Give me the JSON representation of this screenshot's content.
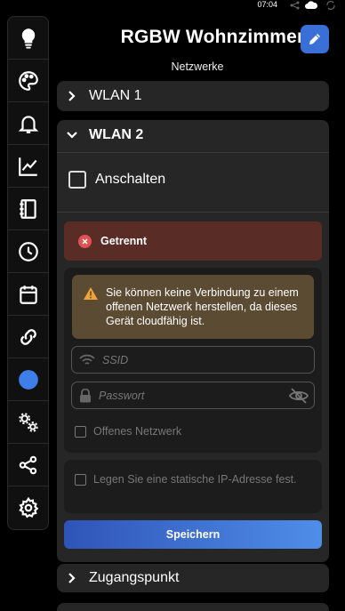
{
  "statusbar": {
    "time": "07:04"
  },
  "sidebar": {
    "items": [
      {
        "icon": "lightbulb-icon"
      },
      {
        "icon": "palette-icon"
      },
      {
        "icon": "bell-icon"
      },
      {
        "icon": "line-chart-icon"
      },
      {
        "icon": "book-icon"
      },
      {
        "icon": "clock-icon"
      },
      {
        "icon": "calendar-icon"
      },
      {
        "icon": "link-icon"
      },
      {
        "icon": "globe-icon",
        "active": true
      },
      {
        "icon": "gears-icon"
      },
      {
        "icon": "share-icon"
      },
      {
        "icon": "settings-icon"
      }
    ],
    "active_color": "#3f7ee8"
  },
  "header": {
    "title": "RGBW Wohnzimmer",
    "subtitle": "Netzwerke"
  },
  "sections": {
    "wlan1": {
      "label": "WLAN 1"
    },
    "wlan2": {
      "label": "WLAN 2",
      "enable_label": "Anschalten",
      "status": "Getrennt",
      "warning": "Sie können keine Verbindung zu einem offenen Netzwerk herstellen, da dieses Gerät cloudfähig ist.",
      "ssid_placeholder": "SSID",
      "password_placeholder": "Passwort",
      "open_network_label": "Offenes Netzwerk",
      "static_ip_label": "Legen Sie eine statische IP-Adresse fest.",
      "save_label": "Speichern"
    },
    "accesspoint": {
      "label": "Zugangspunkt"
    }
  },
  "colors": {
    "error_bg": "#5a2c26",
    "error_icon": "#e05353",
    "warning_bg": "#5c4b33",
    "warning_icon": "#f0a33a",
    "button_gradient_start": "#2f54b8",
    "button_gradient_end": "#4f8ee8"
  }
}
